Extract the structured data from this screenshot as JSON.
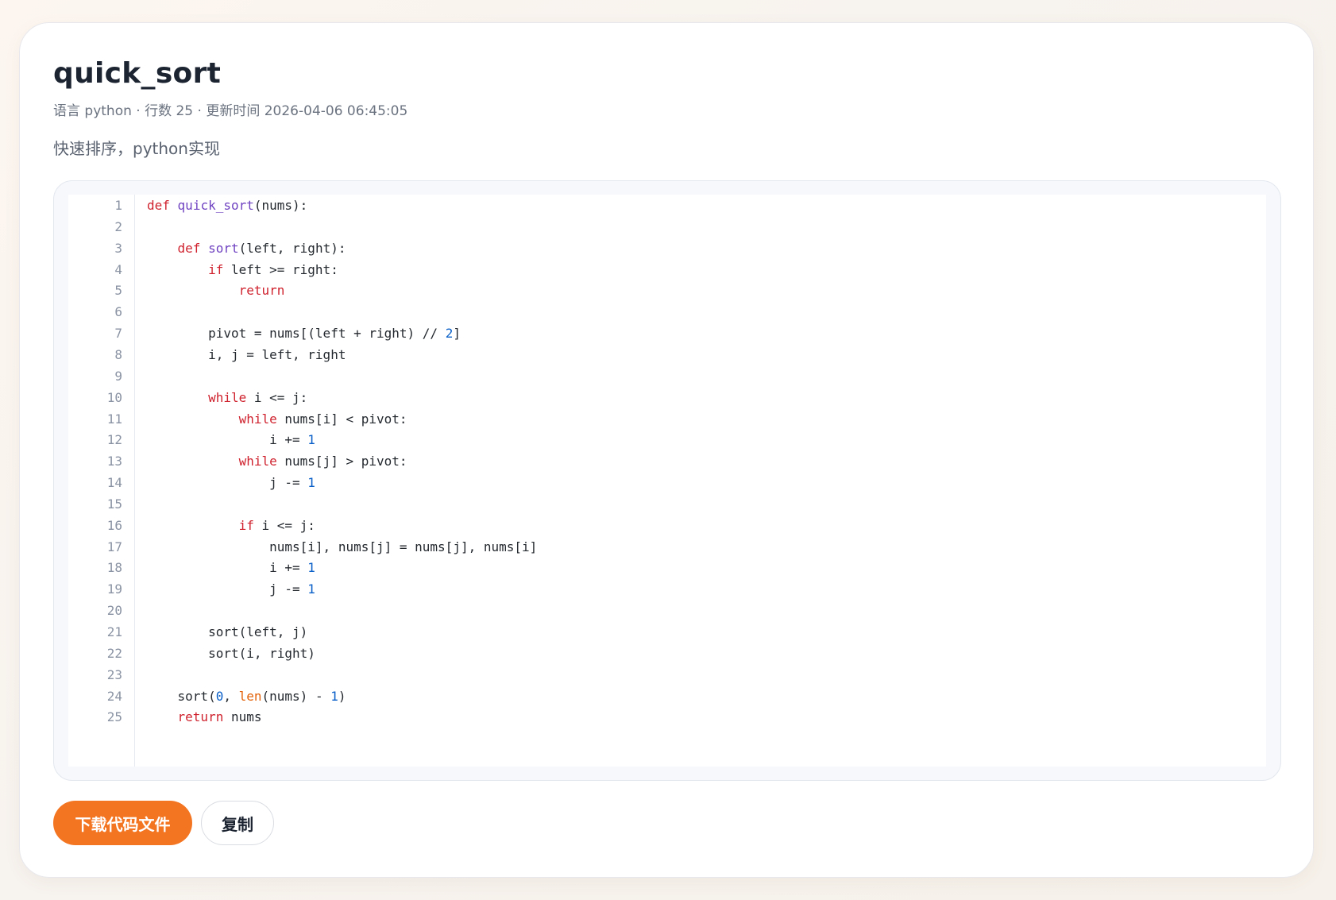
{
  "snippet": {
    "title": "quick_sort",
    "meta": "语言 python · 行数 25 · 更新时间 2026-04-06 06:45:05",
    "description": "快速排序，python实现"
  },
  "code": {
    "lines": [
      [
        {
          "t": "def",
          "c": "kw"
        },
        {
          "t": " ",
          "c": "plain"
        },
        {
          "t": "quick_sort",
          "c": "fn"
        },
        {
          "t": "(nums):",
          "c": "plain"
        }
      ],
      [],
      [
        {
          "t": "    ",
          "c": "plain"
        },
        {
          "t": "def",
          "c": "kw"
        },
        {
          "t": " ",
          "c": "plain"
        },
        {
          "t": "sort",
          "c": "fn"
        },
        {
          "t": "(left, right):",
          "c": "plain"
        }
      ],
      [
        {
          "t": "        ",
          "c": "plain"
        },
        {
          "t": "if",
          "c": "kw"
        },
        {
          "t": " left >= right:",
          "c": "plain"
        }
      ],
      [
        {
          "t": "            ",
          "c": "plain"
        },
        {
          "t": "return",
          "c": "kw"
        }
      ],
      [],
      [
        {
          "t": "        pivot = nums[(left + right) // ",
          "c": "plain"
        },
        {
          "t": "2",
          "c": "num"
        },
        {
          "t": "]",
          "c": "plain"
        }
      ],
      [
        {
          "t": "        i, j = left, right",
          "c": "plain"
        }
      ],
      [],
      [
        {
          "t": "        ",
          "c": "plain"
        },
        {
          "t": "while",
          "c": "kw"
        },
        {
          "t": " i <= j:",
          "c": "plain"
        }
      ],
      [
        {
          "t": "            ",
          "c": "plain"
        },
        {
          "t": "while",
          "c": "kw"
        },
        {
          "t": " nums[i] < pivot:",
          "c": "plain"
        }
      ],
      [
        {
          "t": "                i += ",
          "c": "plain"
        },
        {
          "t": "1",
          "c": "num"
        }
      ],
      [
        {
          "t": "            ",
          "c": "plain"
        },
        {
          "t": "while",
          "c": "kw"
        },
        {
          "t": " nums[j] > pivot:",
          "c": "plain"
        }
      ],
      [
        {
          "t": "                j -= ",
          "c": "plain"
        },
        {
          "t": "1",
          "c": "num"
        }
      ],
      [],
      [
        {
          "t": "            ",
          "c": "plain"
        },
        {
          "t": "if",
          "c": "kw"
        },
        {
          "t": " i <= j:",
          "c": "plain"
        }
      ],
      [
        {
          "t": "                nums[i], nums[j] = nums[j], nums[i]",
          "c": "plain"
        }
      ],
      [
        {
          "t": "                i += ",
          "c": "plain"
        },
        {
          "t": "1",
          "c": "num"
        }
      ],
      [
        {
          "t": "                j -= ",
          "c": "plain"
        },
        {
          "t": "1",
          "c": "num"
        }
      ],
      [],
      [
        {
          "t": "        sort(left, j)",
          "c": "plain"
        }
      ],
      [
        {
          "t": "        sort(i, right)",
          "c": "plain"
        }
      ],
      [],
      [
        {
          "t": "    sort(",
          "c": "plain"
        },
        {
          "t": "0",
          "c": "num"
        },
        {
          "t": ", ",
          "c": "plain"
        },
        {
          "t": "len",
          "c": "bi"
        },
        {
          "t": "(nums) - ",
          "c": "plain"
        },
        {
          "t": "1",
          "c": "num"
        },
        {
          "t": ")",
          "c": "plain"
        }
      ],
      [
        {
          "t": "    ",
          "c": "plain"
        },
        {
          "t": "return",
          "c": "kw"
        },
        {
          "t": " nums",
          "c": "plain"
        }
      ]
    ]
  },
  "actions": {
    "download_label": "下载代码文件",
    "copy_label": "复制"
  },
  "colors": {
    "accent": "#f47521",
    "keyword": "#cf222e",
    "function": "#6f42c1",
    "number": "#0a60c8",
    "builtin": "#e36209"
  }
}
